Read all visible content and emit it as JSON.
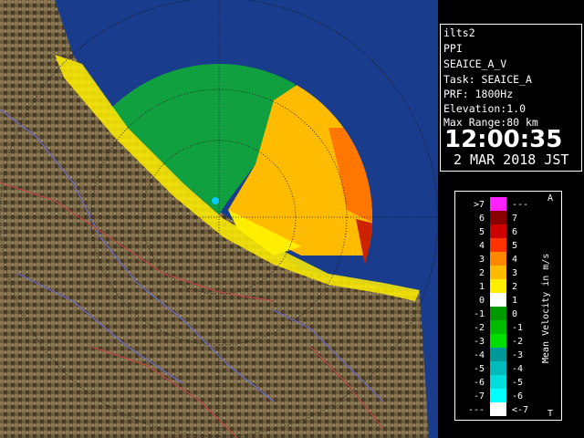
{
  "site": "ilts2",
  "product": "PPI",
  "scan": "SEAICE_A_V",
  "task": "Task: SEAICE_A",
  "prf": "PRF: 1800Hz",
  "elevation": "Elevation:1.0",
  "range": "Max Range:80 km",
  "time": "12:00:35",
  "date": "2 MAR 2018 JST",
  "legend": {
    "title": "Mean Velocity in m/s",
    "top_mark": "A",
    "bottom_mark": "T",
    "left_labels": [
      ">7",
      "6",
      "5",
      "4",
      "3",
      "2",
      "1",
      "0",
      "-1",
      "-2",
      "-3",
      "-4",
      "-5",
      "-6",
      "-7",
      "---"
    ],
    "right_labels": [
      "---",
      "7",
      "6",
      "5",
      "4",
      "3",
      "2",
      "1",
      "0",
      "-1",
      "-2",
      "-3",
      "-4",
      "-5",
      "-6",
      "<-7"
    ],
    "colors": [
      "#ff22ff",
      "#880000",
      "#cc0000",
      "#ff3300",
      "#ff8800",
      "#ffbb00",
      "#ffee00",
      "#ffffff",
      "#009900",
      "#00bb00",
      "#00dd00",
      "#009999",
      "#00bbbb",
      "#00dddd",
      "#00ffff",
      "#ffffff"
    ]
  },
  "colors": {
    "land": "#7a6a4a",
    "sea": "#1a3c8c",
    "range_ring": "#000000",
    "coast_yellow": "#ffee00"
  }
}
